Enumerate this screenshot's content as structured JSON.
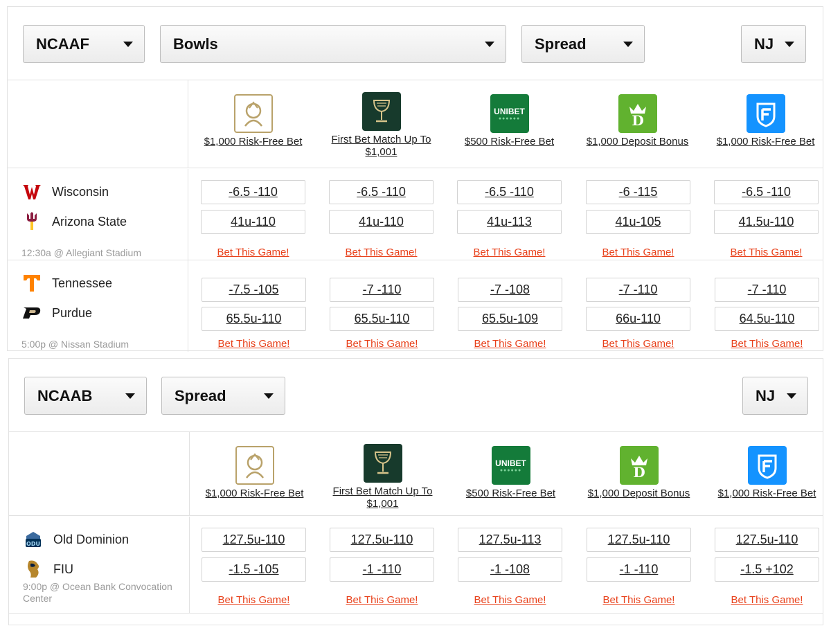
{
  "panel1": {
    "filters": {
      "sport": "NCAAF",
      "category": "Bowls",
      "market": "Spread",
      "state": "NJ"
    },
    "books": [
      {
        "logo": "betmgm-logo",
        "promo": "$1,000 Risk-Free Bet"
      },
      {
        "logo": "pointsbet-goblet-logo",
        "promo": "First Bet Match Up To $1,001"
      },
      {
        "logo": "unibet-logo",
        "promo": "$500 Risk-Free Bet",
        "logo_text": "UNIBET"
      },
      {
        "logo": "draftkings-logo",
        "promo": "$1,000 Deposit Bonus"
      },
      {
        "logo": "fanduel-logo",
        "promo": "$1,000 Risk-Free Bet"
      }
    ],
    "games": [
      {
        "team1": {
          "name": "Wisconsin",
          "logo": "wisconsin-w-icon"
        },
        "team2": {
          "name": "Arizona State",
          "logo": "arizona-state-pitchfork-icon"
        },
        "info": "12:30a @ Allegiant Stadium",
        "line1": [
          "-6.5 -110",
          "-6.5 -110",
          "-6.5 -110",
          "-6 -115",
          "-6.5 -110"
        ],
        "line2": [
          "41u-110",
          "41u-110",
          "41u-113",
          "41u-105",
          "41.5u-110"
        ],
        "cta": "Bet This Game!"
      },
      {
        "team1": {
          "name": "Tennessee",
          "logo": "tennessee-t-icon"
        },
        "team2": {
          "name": "Purdue",
          "logo": "purdue-p-icon"
        },
        "info": "5:00p @ Nissan Stadium",
        "line1": [
          "-7.5 -105",
          "-7 -110",
          "-7 -108",
          "-7 -110",
          "-7 -110"
        ],
        "line2": [
          "65.5u-110",
          "65.5u-110",
          "65.5u-109",
          "66u-110",
          "64.5u-110"
        ],
        "cta": "Bet This Game!"
      }
    ]
  },
  "panel2": {
    "filters": {
      "sport": "NCAAB",
      "market": "Spread",
      "state": "NJ"
    },
    "books": [
      {
        "logo": "betmgm-logo",
        "promo": "$1,000 Risk-Free Bet"
      },
      {
        "logo": "pointsbet-goblet-logo",
        "promo": "First Bet Match Up To $1,001"
      },
      {
        "logo": "unibet-logo",
        "promo": "$500 Risk-Free Bet",
        "logo_text": "UNIBET"
      },
      {
        "logo": "draftkings-logo",
        "promo": "$1,000 Deposit Bonus"
      },
      {
        "logo": "fanduel-logo",
        "promo": "$1,000 Risk-Free Bet"
      }
    ],
    "games": [
      {
        "team1": {
          "name": "Old Dominion",
          "logo": "old-dominion-icon"
        },
        "team2": {
          "name": "FIU",
          "logo": "fiu-panther-icon"
        },
        "info": "9:00p @ Ocean Bank Convocation Center",
        "line1": [
          "127.5u-110",
          "127.5u-110",
          "127.5u-113",
          "127.5u-110",
          "127.5u-110"
        ],
        "line2": [
          "-1.5 -105",
          "-1 -110",
          "-1 -108",
          "-1 -110",
          "-1.5 +102"
        ],
        "cta": "Bet This Game!"
      }
    ]
  },
  "colors": {
    "cta": "#e8401a",
    "border": "#e2e2e2",
    "muted_text": "#9a9a9a"
  }
}
